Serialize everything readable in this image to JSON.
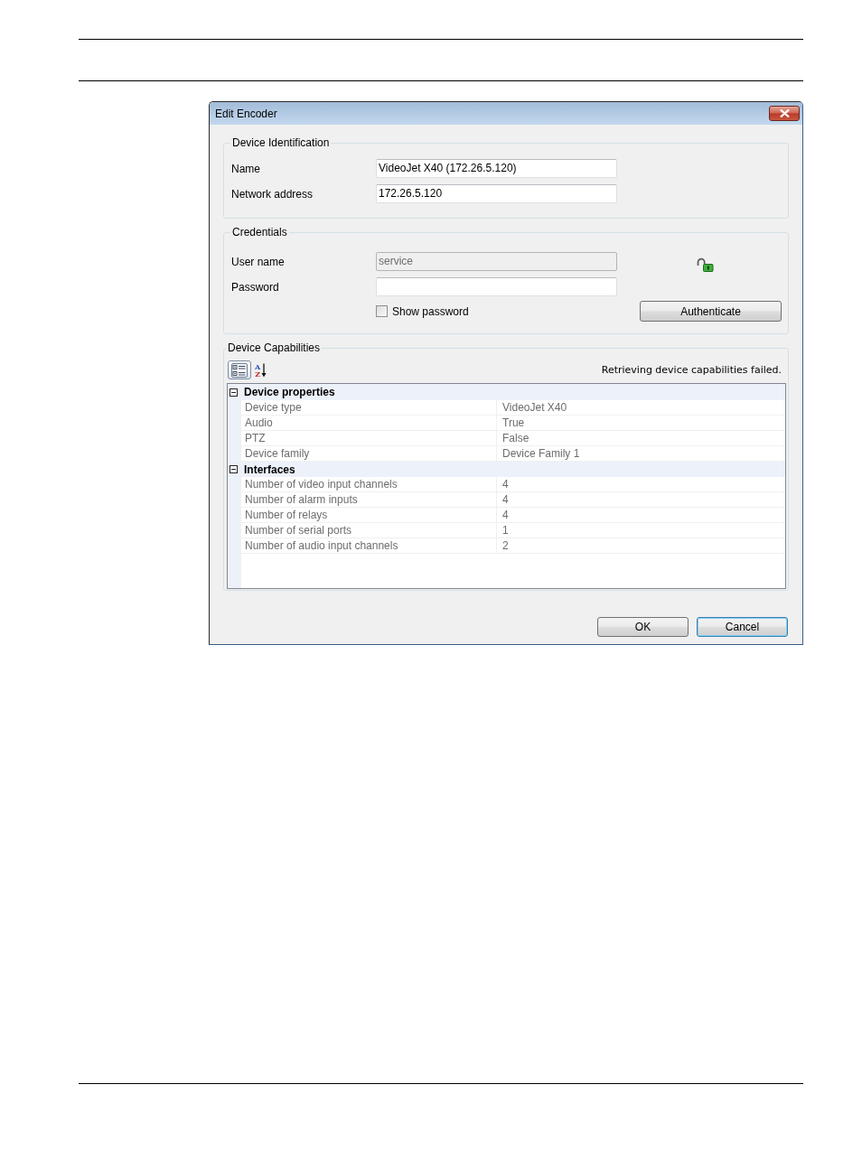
{
  "dialog": {
    "title": "Edit Encoder"
  },
  "device_identification": {
    "title": "Device Identification",
    "fields": [
      {
        "label": "Name",
        "value": "VideoJet X40 (172.26.5.120)",
        "disabled": false
      },
      {
        "label": "Network address",
        "value": "172.26.5.120",
        "disabled": false
      }
    ]
  },
  "credentials": {
    "title": "Credentials",
    "fields": [
      {
        "label": "User name",
        "value": "service",
        "disabled": true
      },
      {
        "label": "Password",
        "disabled": false
      }
    ],
    "show_password": {
      "label": "Show password",
      "checked": false
    },
    "authenticate_button": "Authenticate"
  },
  "device_capabilities": {
    "title": "Device Capabilities",
    "toolbar": [
      {
        "kind": "categorized",
        "selected": true
      },
      {
        "kind": "alphabetical",
        "selected": false,
        "letters": [
          "A",
          "Z"
        ]
      }
    ],
    "status": "Retrieving device capabilities failed.",
    "read_only": true,
    "categories": [
      {
        "name": "Device properties",
        "expanded": true,
        "properties": [
          {
            "name": "Device type",
            "value": "VideoJet X40"
          },
          {
            "name": "Audio",
            "value": "True"
          },
          {
            "name": "PTZ",
            "value": "False"
          },
          {
            "name": "Device family",
            "value": "Device Family 1"
          }
        ]
      },
      {
        "name": "Interfaces",
        "expanded": true,
        "properties": [
          {
            "name": "Number of video input channels",
            "value": "4"
          },
          {
            "name": "Number of alarm inputs",
            "value": "4"
          },
          {
            "name": "Number of relays",
            "value": "4"
          },
          {
            "name": "Number of serial ports",
            "value": "1"
          },
          {
            "name": "Number of audio input channels",
            "value": "2"
          }
        ]
      }
    ]
  },
  "buttons": [
    {
      "label": "OK",
      "default": false
    },
    {
      "label": "Cancel",
      "default": true
    }
  ]
}
